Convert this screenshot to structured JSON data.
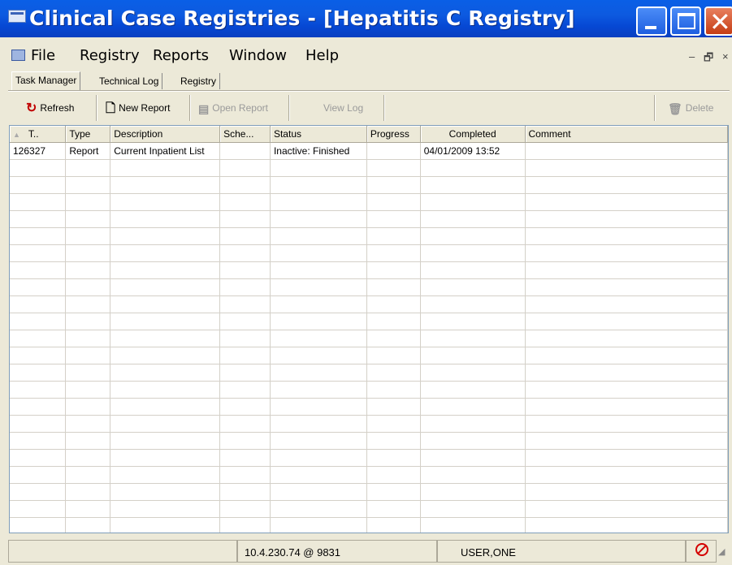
{
  "window": {
    "title": "Clinical Case Registries - [Hepatitis C Registry]"
  },
  "menu": {
    "items": [
      "File",
      "Registry",
      "Reports",
      "Window",
      "Help"
    ],
    "mdi_min": "–",
    "mdi_restore": "🗗",
    "mdi_close": "×"
  },
  "tabs": [
    "Task Manager",
    "Technical Log",
    "Registry"
  ],
  "toolbar": {
    "refresh": "Refresh",
    "new_report": "New Report",
    "open_report": "Open Report",
    "view_log": "View Log",
    "delete": "Delete"
  },
  "table": {
    "sort_indicator": "▲",
    "columns": [
      "T..",
      "Type",
      "Description",
      "Sche...",
      "Status",
      "Progress",
      "Completed",
      "Comment"
    ],
    "rows": [
      [
        "126327",
        "Report",
        "Current Inpatient List",
        "",
        "Inactive: Finished",
        "",
        "04/01/2009 13:52",
        ""
      ]
    ]
  },
  "status": {
    "server": "10.4.230.74 @ 9831",
    "user": "USER,ONE"
  },
  "colors": {
    "title_bar": "#0a5fe6",
    "close_button": "#c53d14",
    "error_icon": "#d40000"
  }
}
